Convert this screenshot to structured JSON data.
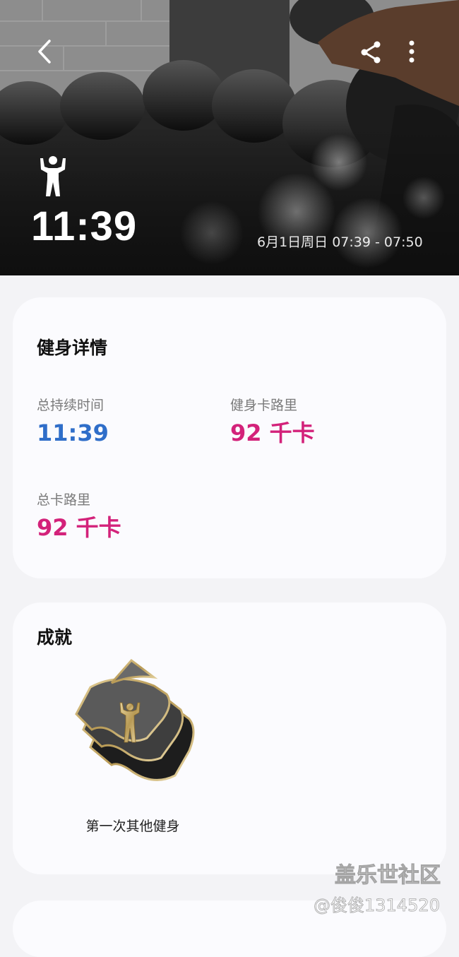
{
  "hero": {
    "activity_icon": "person-flexing-icon",
    "duration": "11:39",
    "date_time": "6月1日周日 07:39 - 07:50",
    "back_icon": "chevron-left-icon",
    "share_icon": "share-icon",
    "more_icon": "more-vertical-icon"
  },
  "details": {
    "title": "健身详情",
    "stats": [
      {
        "label": "总持续时间",
        "value": "11:39",
        "color": "#2f6ec9"
      },
      {
        "label": "健身卡路里",
        "value": "92 千卡",
        "color": "#d3227a"
      },
      {
        "label": "总卡路里",
        "value": "92 千卡",
        "color": "#d3227a"
      }
    ]
  },
  "achievements": {
    "title": "成就",
    "badge_label": "第一次其他健身",
    "badge_icon": "achievement-badge-icon"
  },
  "watermark": {
    "line1": "盖乐世社区",
    "line2": "@俊俊1314520"
  }
}
